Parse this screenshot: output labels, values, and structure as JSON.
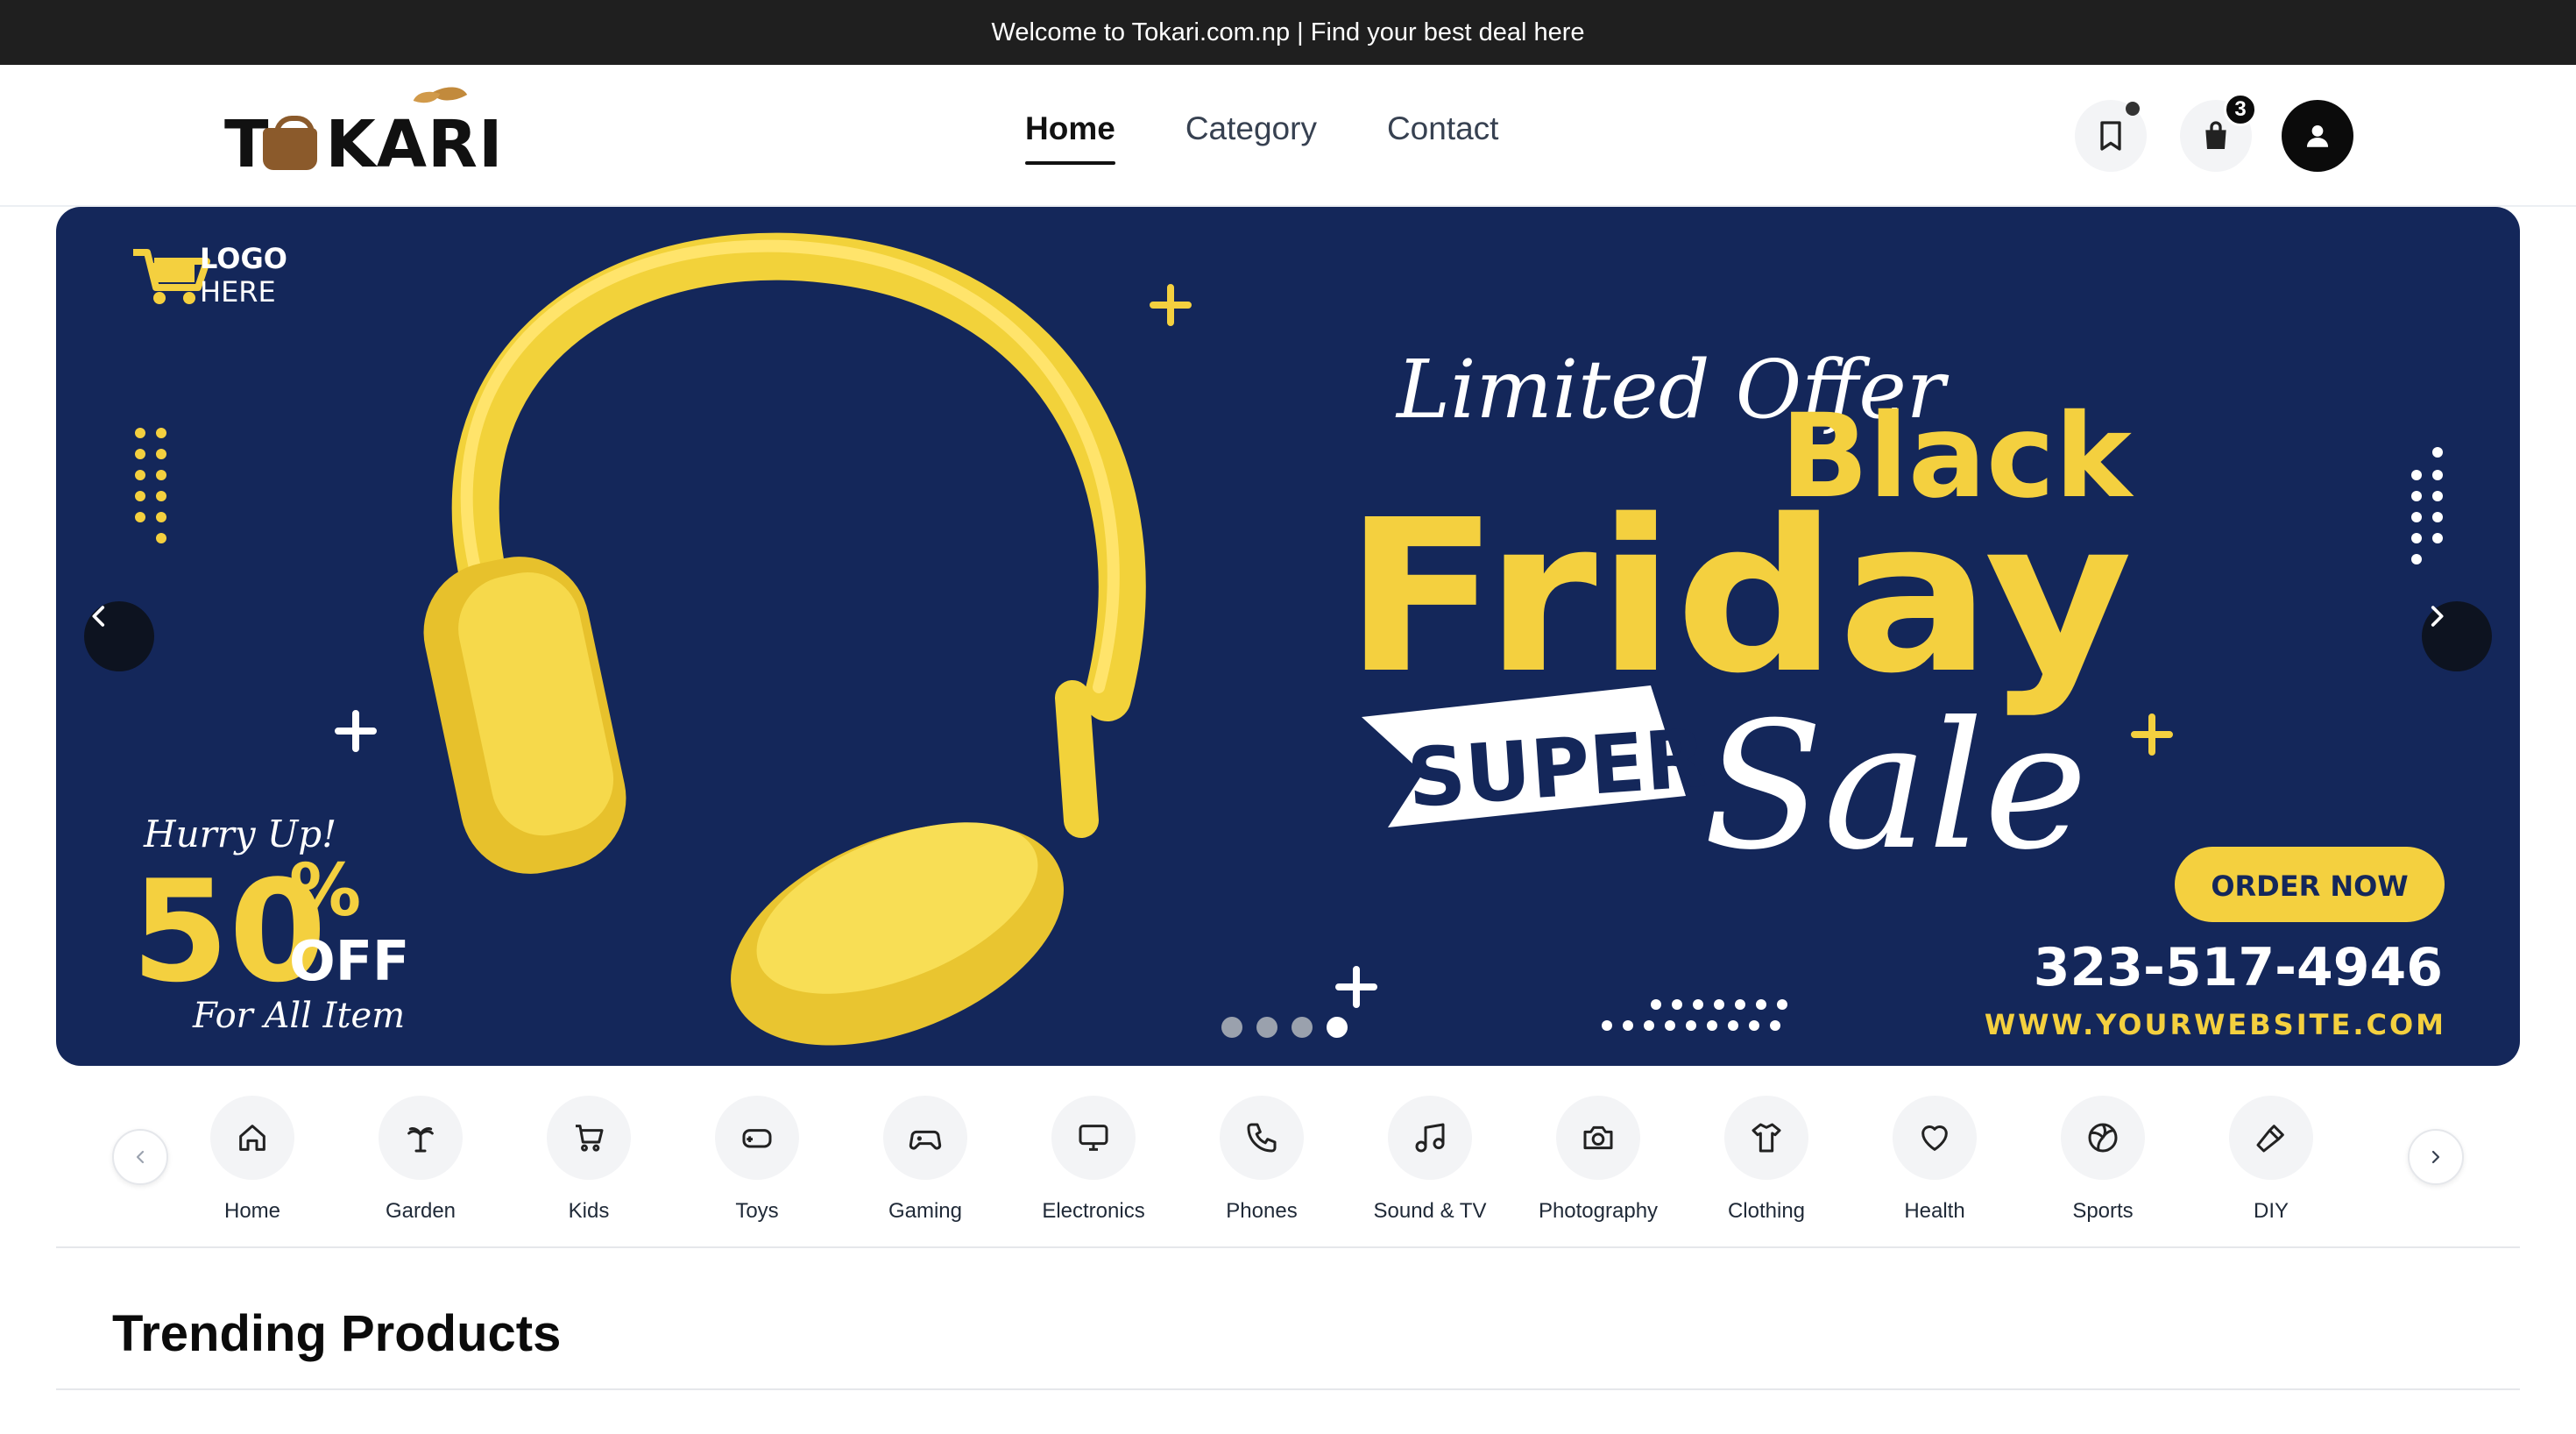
{
  "announcement": "Welcome to Tokari.com.np | Find your best deal here",
  "brand": {
    "name": "TOKARI"
  },
  "nav": {
    "items": [
      {
        "label": "Home",
        "active": true
      },
      {
        "label": "Category",
        "active": false
      },
      {
        "label": "Contact",
        "active": false
      }
    ]
  },
  "header_actions": {
    "bookmark_icon": "bookmark-icon",
    "cart_icon": "shopping-bag-icon",
    "cart_count": "3",
    "account_icon": "user-icon"
  },
  "banner": {
    "logo_line1": "LOGO",
    "logo_line2": "HERE",
    "tagline": "Limited Offer",
    "headline1": "Black",
    "headline2": "Friday",
    "super": "SUPER",
    "sale": "Sale",
    "hurry": "Hurry Up!",
    "discount_number": "50",
    "discount_percent": "%",
    "discount_off": "OFF",
    "discount_sub": "For All Item",
    "cta": "ORDER NOW",
    "phone": "323-517-4946",
    "website": "WWW.YOURWEBSITE.COM",
    "slides_total": 4,
    "active_slide": 4,
    "colors": {
      "background": "#14275a",
      "accent": "#f4d03f",
      "text": "#ffffff"
    }
  },
  "categories": [
    {
      "label": "Home",
      "icon": "house-icon"
    },
    {
      "label": "Garden",
      "icon": "palm-tree-icon"
    },
    {
      "label": "Kids",
      "icon": "cart-icon"
    },
    {
      "label": "Toys",
      "icon": "gamepad-icon"
    },
    {
      "label": "Gaming",
      "icon": "controller-icon"
    },
    {
      "label": "Electronics",
      "icon": "monitor-icon"
    },
    {
      "label": "Phones",
      "icon": "phone-icon"
    },
    {
      "label": "Sound & TV",
      "icon": "music-icon"
    },
    {
      "label": "Photography",
      "icon": "camera-icon"
    },
    {
      "label": "Clothing",
      "icon": "shirt-icon"
    },
    {
      "label": "Health",
      "icon": "heart-icon"
    },
    {
      "label": "Sports",
      "icon": "volleyball-icon"
    },
    {
      "label": "DIY",
      "icon": "hammer-icon"
    }
  ],
  "section": {
    "trending_title": "Trending Products"
  }
}
